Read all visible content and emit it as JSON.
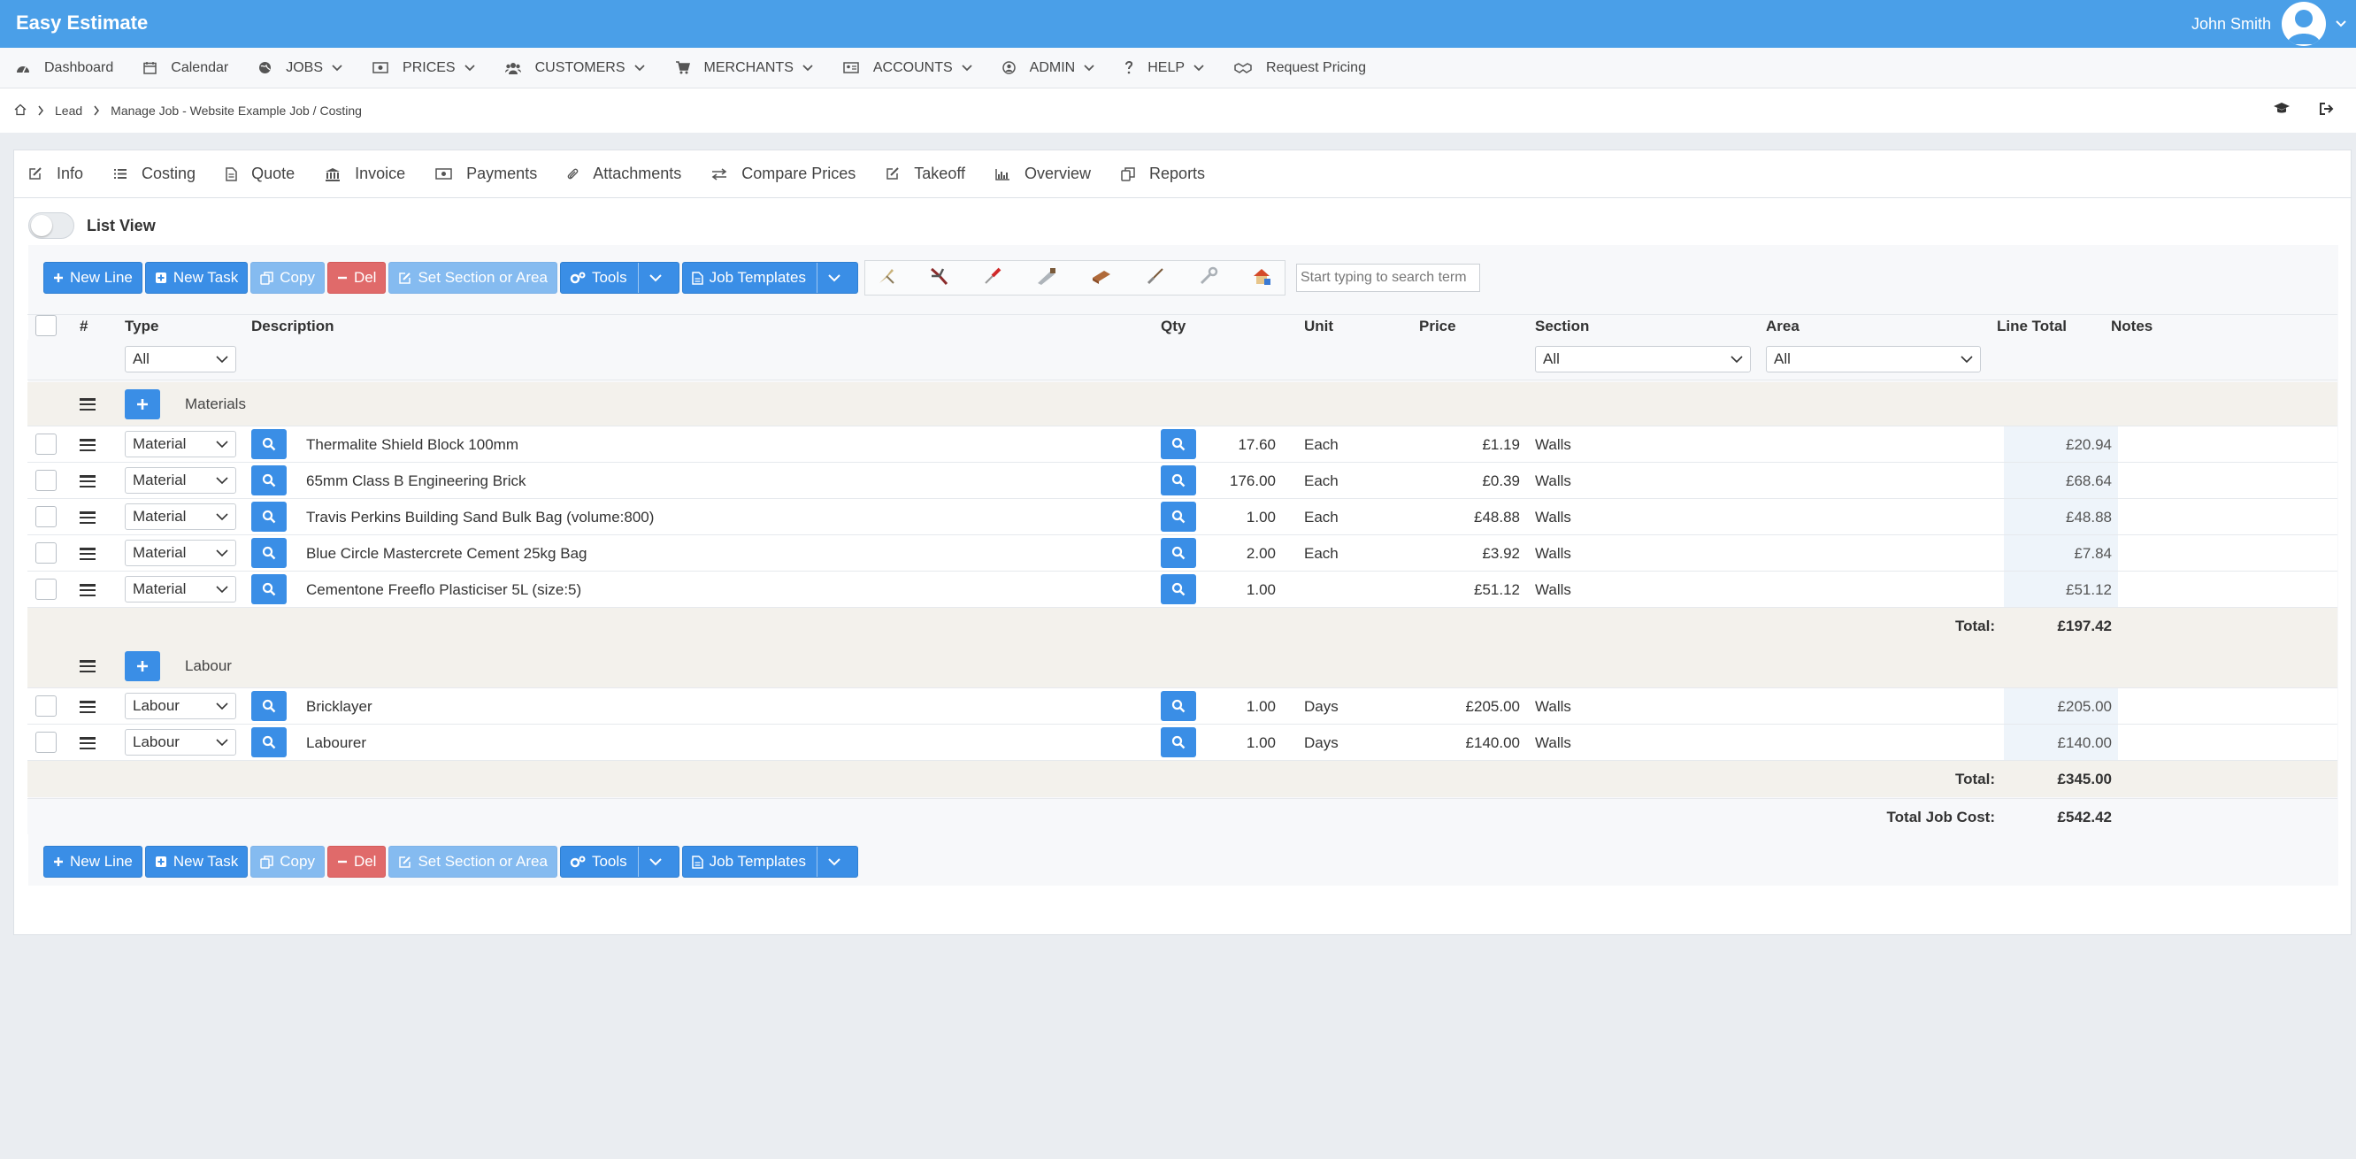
{
  "app": {
    "brand": "Easy Estimate",
    "user_name": "John Smith"
  },
  "nav": [
    {
      "label": "Dashboard",
      "icon": "dashboard-icon",
      "dropdown": false
    },
    {
      "label": "Calendar",
      "icon": "calendar-icon",
      "dropdown": false
    },
    {
      "label": "JOBS",
      "icon": "globe-icon",
      "dropdown": true
    },
    {
      "label": "PRICES",
      "icon": "money-icon",
      "dropdown": true
    },
    {
      "label": "CUSTOMERS",
      "icon": "users-icon",
      "dropdown": true
    },
    {
      "label": "MERCHANTS",
      "icon": "cart-icon",
      "dropdown": true
    },
    {
      "label": "ACCOUNTS",
      "icon": "id-card-icon",
      "dropdown": true
    },
    {
      "label": "ADMIN",
      "icon": "user-circle-icon",
      "dropdown": true
    },
    {
      "label": "HELP",
      "icon": "question-icon",
      "dropdown": true
    },
    {
      "label": "Request Pricing",
      "icon": "handshake-icon",
      "dropdown": false
    }
  ],
  "breadcrumb": {
    "lead": "Lead",
    "current": "Manage Job - Website Example Job / Costing"
  },
  "tabs": [
    "Info",
    "Costing",
    "Quote",
    "Invoice",
    "Payments",
    "Attachments",
    "Compare Prices",
    "Takeoff",
    "Overview",
    "Reports"
  ],
  "list_view_label": "List View",
  "toolbar": {
    "new_line": "New Line",
    "new_task": "New Task",
    "copy": "Copy",
    "del": "Del",
    "set_section": "Set Section or Area",
    "tools": "Tools",
    "job_templates": "Job Templates",
    "search_placeholder": "Start typing to search term"
  },
  "table": {
    "headers": {
      "num": "#",
      "type": "Type",
      "description": "Description",
      "qty": "Qty",
      "unit": "Unit",
      "price": "Price",
      "section": "Section",
      "area": "Area",
      "line_total": "Line Total",
      "notes": "Notes"
    },
    "filters": {
      "type": "All",
      "section": "All",
      "area": "All"
    },
    "groups": [
      {
        "name": "Materials",
        "rows": [
          {
            "type": "Material",
            "description": "Thermalite Shield Block 100mm",
            "qty": "17.60",
            "unit": "Each",
            "price": "£1.19",
            "section": "Walls",
            "line_total": "£20.94"
          },
          {
            "type": "Material",
            "description": "65mm Class B Engineering Brick",
            "qty": "176.00",
            "unit": "Each",
            "price": "£0.39",
            "section": "Walls",
            "line_total": "£68.64"
          },
          {
            "type": "Material",
            "description": "Travis Perkins Building Sand Bulk Bag (volume:800)",
            "qty": "1.00",
            "unit": "Each",
            "price": "£48.88",
            "section": "Walls",
            "line_total": "£48.88"
          },
          {
            "type": "Material",
            "description": "Blue Circle Mastercrete Cement 25kg Bag",
            "qty": "2.00",
            "unit": "Each",
            "price": "£3.92",
            "section": "Walls",
            "line_total": "£7.84"
          },
          {
            "type": "Material",
            "description": "Cementone Freeflo Plasticiser 5L (size:5)",
            "qty": "1.00",
            "unit": "",
            "price": "£51.12",
            "section": "Walls",
            "line_total": "£51.12"
          }
        ],
        "total_label": "Total:",
        "total": "£197.42"
      },
      {
        "name": "Labour",
        "rows": [
          {
            "type": "Labour",
            "description": "Bricklayer",
            "qty": "1.00",
            "unit": "Days",
            "price": "£205.00",
            "section": "Walls",
            "line_total": "£205.00"
          },
          {
            "type": "Labour",
            "description": "Labourer",
            "qty": "1.00",
            "unit": "Days",
            "price": "£140.00",
            "section": "Walls",
            "line_total": "£140.00"
          }
        ],
        "total_label": "Total:",
        "total": "£345.00"
      }
    ],
    "job_total_label": "Total Job Cost:",
    "job_total": "£542.42"
  },
  "colors": {
    "brand_bar": "#4a9fe8",
    "primary_button": "#3a8ee6",
    "danger_button": "#e06a6a",
    "group_row": "#f3f1ec"
  }
}
